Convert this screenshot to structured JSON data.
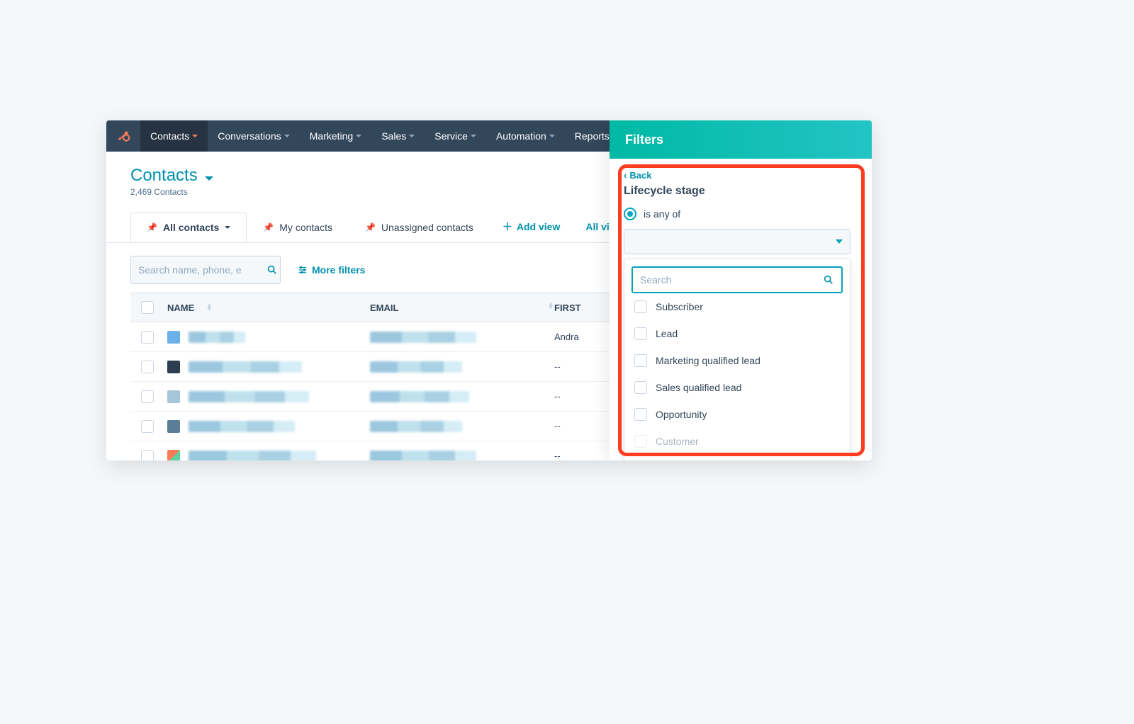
{
  "nav": {
    "items": [
      {
        "label": "Contacts",
        "active": true
      },
      {
        "label": "Conversations"
      },
      {
        "label": "Marketing"
      },
      {
        "label": "Sales"
      },
      {
        "label": "Service"
      },
      {
        "label": "Automation"
      },
      {
        "label": "Reports"
      }
    ]
  },
  "header": {
    "title": "Contacts",
    "subtitle": "2,469 Contacts"
  },
  "tabs": [
    {
      "label": "All contacts",
      "active": true,
      "hasCaret": true
    },
    {
      "label": "My contacts"
    },
    {
      "label": "Unassigned contacts"
    }
  ],
  "tabs_actions": {
    "add_view": "Add view",
    "all_views": "All views"
  },
  "toolbar": {
    "search_placeholder": "Search name, phone, e",
    "more_filters": "More filters"
  },
  "table": {
    "columns": {
      "name": "NAME",
      "email": "EMAIL",
      "first": "FIRST"
    },
    "rows": [
      {
        "first": "Andra"
      },
      {
        "first": "--"
      },
      {
        "first": "--"
      },
      {
        "first": "--"
      },
      {
        "first": "--"
      }
    ]
  },
  "panel": {
    "title": "Filters",
    "back": "Back",
    "filter_name": "Lifecycle stage",
    "condition": "is any of",
    "search_placeholder": "Search",
    "options": [
      "Subscriber",
      "Lead",
      "Marketing qualified lead",
      "Sales qualified lead",
      "Opportunity",
      "Customer"
    ]
  }
}
